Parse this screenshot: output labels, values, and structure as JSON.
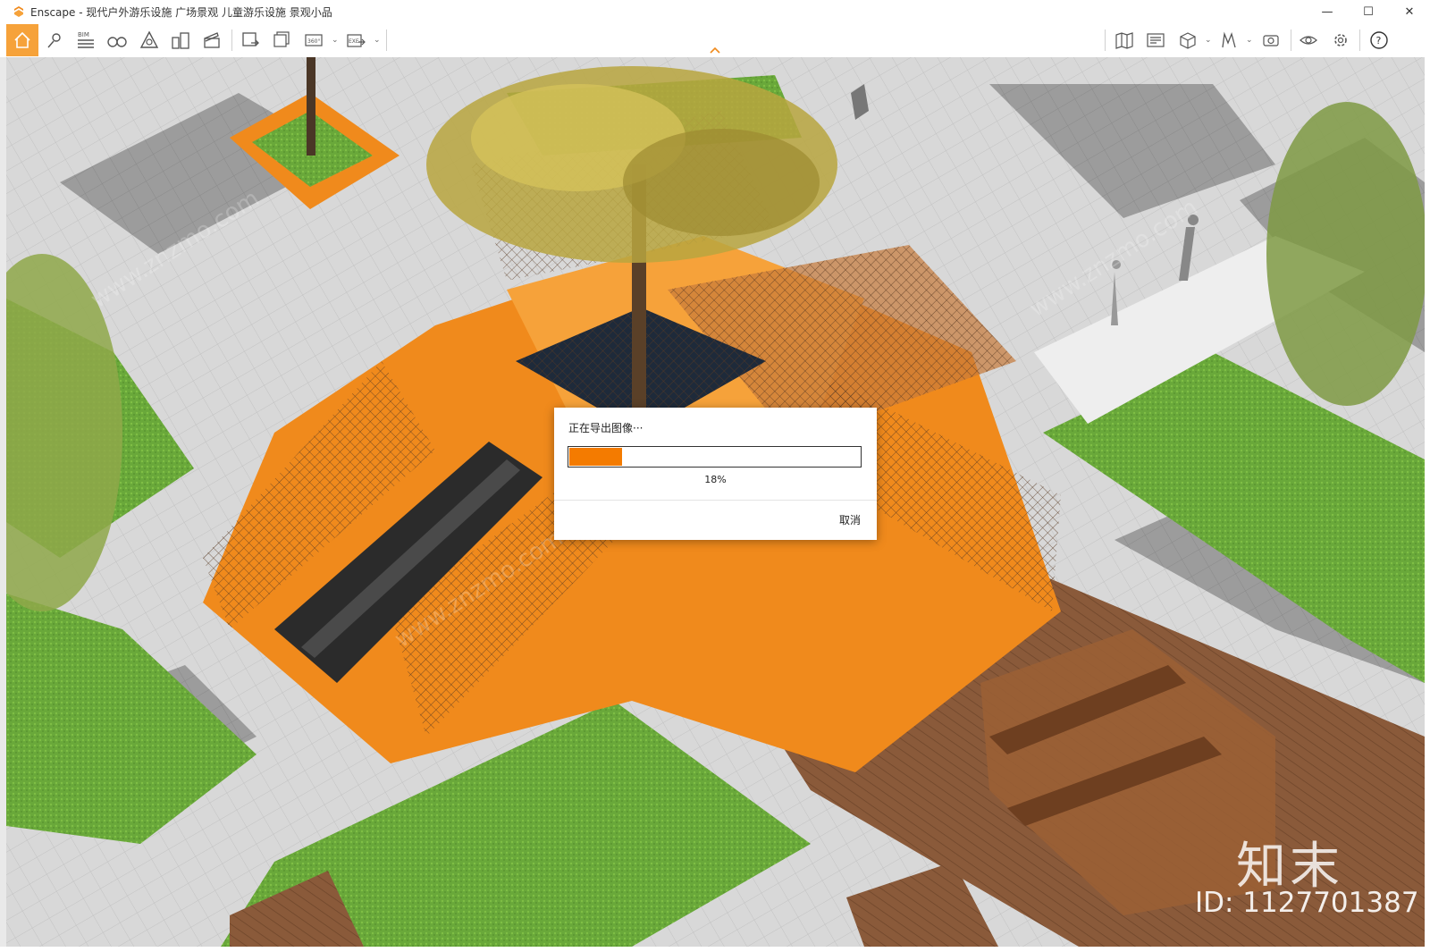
{
  "window": {
    "title": "Enscape - 现代户外游乐设施 广场景观 儿童游乐设施 景观小品",
    "minimize": "—",
    "maximize": "☐",
    "close": "✕"
  },
  "toolbar": {
    "bim_label": "BIM",
    "pano_label": "360°",
    "exe_label": "EXE",
    "icons": [
      "home-icon",
      "asset-library-icon",
      "bim-icon",
      "binoculars-icon",
      "sketch-icon",
      "buildings-icon",
      "clapper-icon",
      "screenshot-icon",
      "batch-render-icon",
      "panorama-icon",
      "exe-export-icon",
      "map-icon",
      "view-management-icon",
      "cube-icon",
      "collaboration-icon",
      "camera-icon",
      "visual-settings-icon",
      "settings-icon",
      "help-icon"
    ]
  },
  "dialog": {
    "title": "正在导出图像···",
    "progress": 0.18,
    "percent_label": "18%",
    "cancel_label": "取消"
  },
  "watermark": {
    "logo": "知末",
    "id": "ID: 1127701387",
    "diagonal": "www.znzmo.com"
  },
  "colors": {
    "accent": "#f6a23a",
    "progress": "#f47b00"
  }
}
